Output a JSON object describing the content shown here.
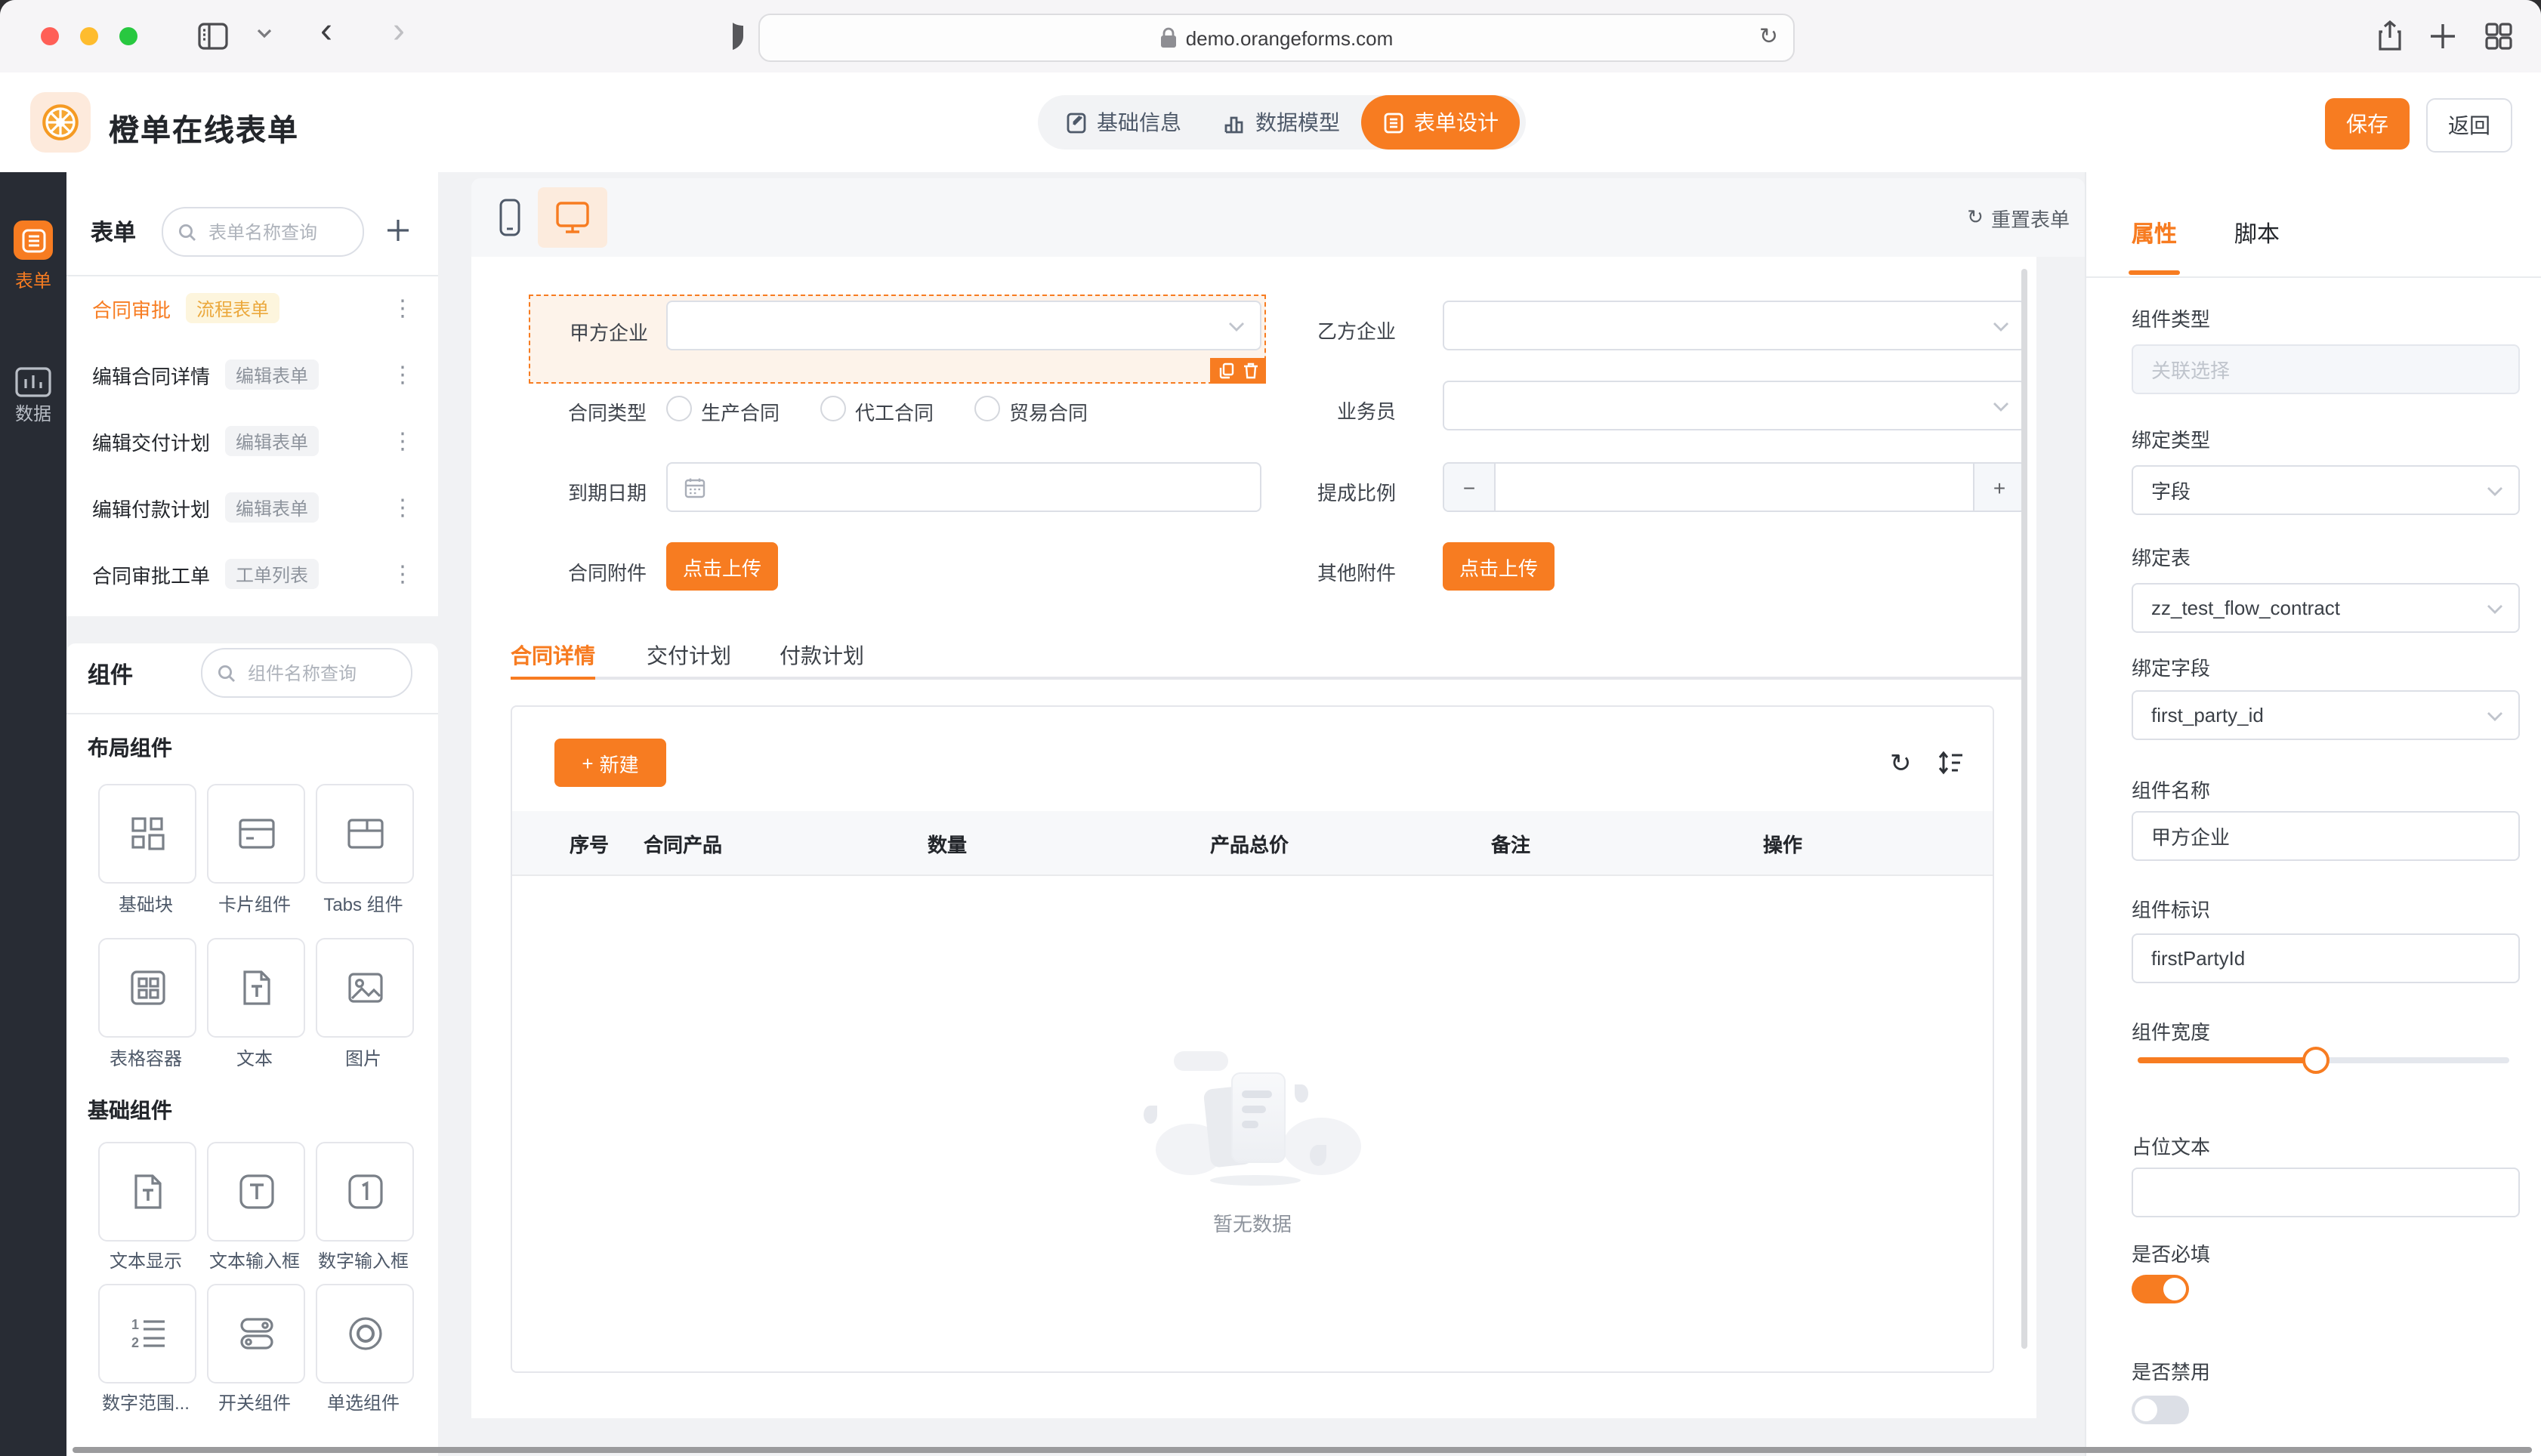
{
  "browser": {
    "url": "demo.orangeforms.com"
  },
  "icons": {
    "back": "‹",
    "forward": "›",
    "reload": "↻",
    "plus": "+",
    "minus": "−",
    "kebab": "⋮",
    "refresh": "↻"
  },
  "colors": {
    "primary": "#f77c21",
    "tag_flow_bg": "#fdf5dd",
    "tag_flow_text": "#eba83c"
  },
  "header": {
    "title": "橙单在线表单",
    "nav": [
      {
        "label": "基础信息"
      },
      {
        "label": "数据模型"
      },
      {
        "label": "表单设计"
      }
    ],
    "save": "保存",
    "back": "返回"
  },
  "rail": {
    "form": "表单",
    "data": "数据"
  },
  "forms": {
    "title": "表单",
    "search_placeholder": "表单名称查询",
    "items": [
      {
        "name": "合同审批",
        "tag": "流程表单"
      },
      {
        "name": "编辑合同详情",
        "tag": "编辑表单"
      },
      {
        "name": "编辑交付计划",
        "tag": "编辑表单"
      },
      {
        "name": "编辑付款计划",
        "tag": "编辑表单"
      },
      {
        "name": "合同审批工单",
        "tag": "工单列表"
      }
    ]
  },
  "components": {
    "title": "组件",
    "search_placeholder": "组件名称查询",
    "group1": {
      "title": "布局组件",
      "items": [
        {
          "label": "基础块"
        },
        {
          "label": "卡片组件"
        },
        {
          "label": "Tabs 组件"
        },
        {
          "label": "表格容器"
        },
        {
          "label": "文本"
        },
        {
          "label": "图片"
        }
      ]
    },
    "group2": {
      "title": "基础组件",
      "items": [
        {
          "label": "文本显示"
        },
        {
          "label": "文本输入框"
        },
        {
          "label": "数字输入框"
        },
        {
          "label": "数字范围..."
        },
        {
          "label": "开关组件"
        },
        {
          "label": "单选组件"
        }
      ]
    }
  },
  "canvas": {
    "reset": "重置表单",
    "row1_left_label": "甲方企业",
    "row1_right_label": "乙方企业",
    "row2_label": "合同类型",
    "radios": [
      {
        "label": "生产合同"
      },
      {
        "label": "代工合同"
      },
      {
        "label": "贸易合同"
      }
    ],
    "row2_right_label": "业务员",
    "row3_left_label": "到期日期",
    "row3_right_label": "提成比例",
    "row4_left_label": "合同附件",
    "row4_right_label": "其他附件",
    "upload": "点击上传",
    "tabs": [
      {
        "label": "合同详情"
      },
      {
        "label": "交付计划"
      },
      {
        "label": "付款计划"
      }
    ],
    "new_button": "新建",
    "table_headers": [
      "序号",
      "合同产品",
      "数量",
      "产品总价",
      "备注",
      "操作"
    ],
    "empty_text": "暂无数据"
  },
  "inspector": {
    "tabs": [
      {
        "label": "属性"
      },
      {
        "label": "脚本"
      }
    ],
    "fields": {
      "component_type": {
        "label": "组件类型",
        "value": "关联选择"
      },
      "bind_type": {
        "label": "绑定类型",
        "value": "字段"
      },
      "bind_table": {
        "label": "绑定表",
        "value": "zz_test_flow_contract"
      },
      "bind_field": {
        "label": "绑定字段",
        "value": "first_party_id"
      },
      "component_name": {
        "label": "组件名称",
        "value": "甲方企业"
      },
      "component_key": {
        "label": "组件标识",
        "value": "firstPartyId"
      },
      "component_width": {
        "label": "组件宽度",
        "percent": 48
      },
      "placeholder_text": {
        "label": "占位文本",
        "value": ""
      },
      "required": {
        "label": "是否必填",
        "on": true
      },
      "disabled": {
        "label": "是否禁用",
        "on": false
      }
    }
  }
}
